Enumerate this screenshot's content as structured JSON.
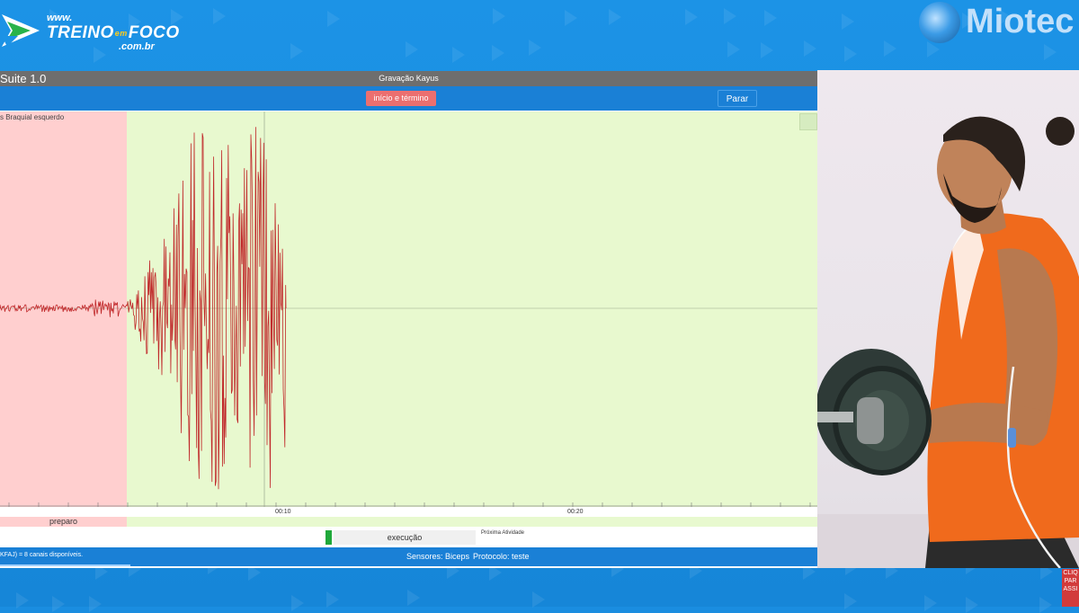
{
  "brand": {
    "www": "www.",
    "name_part1": "TREINO",
    "name_em": "em",
    "name_part2": "FOCO",
    "domain": ".com.br",
    "partner": "Miotec"
  },
  "app": {
    "title": "Suite 1.0",
    "recording_name": "Gravação Kayus",
    "start_button": "início e término",
    "stop_button": "Parar",
    "channel_label": "s Braquial esquerdo",
    "time_ticks": [
      "00:10",
      "00:20"
    ],
    "phases": {
      "prep": "preparo",
      "exec": "execução",
      "next": "Próxima Atividade"
    },
    "status": {
      "left": "KFAJ) = 8 canais disponíveis.",
      "sensors": "Sensores: Biceps",
      "protocol": "Protocolo: teste"
    }
  },
  "colors": {
    "prep_zone": "#ffcfcf",
    "exec_zone": "#e8f9cf",
    "signal": "#c0282a",
    "toolbar": "#1a80d6",
    "start_button": "#ec6f6f",
    "exec_indicator": "#1fa83a"
  },
  "cta": {
    "lines": [
      "CLIQ",
      "PAR",
      "ASSI"
    ]
  }
}
